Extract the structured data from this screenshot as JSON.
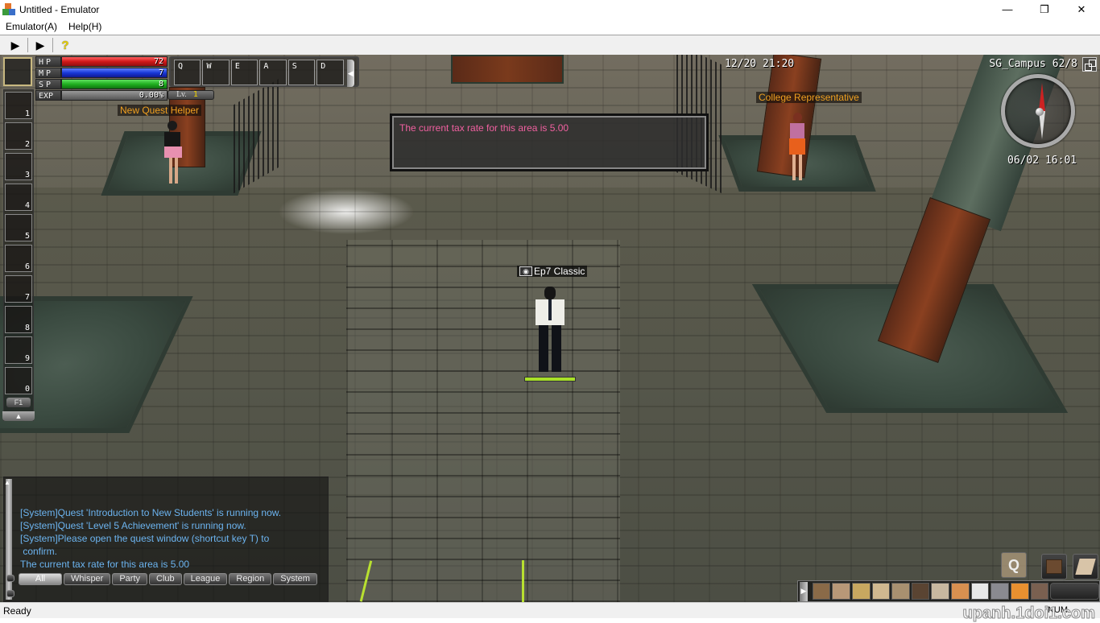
{
  "window": {
    "title": "Untitled - Emulator",
    "minimize_icon": "minimize-icon",
    "restore_icon": "restore-icon",
    "close_icon": "close-icon"
  },
  "menu": {
    "items": [
      "Emulator(A)",
      "Help(H)"
    ]
  },
  "toolbar": {
    "play_icon": "play-icon",
    "step_icon": "step-icon",
    "help_icon": "help-icon",
    "play_glyph": "▶",
    "step_glyph": "▶",
    "help_glyph": "?"
  },
  "hud": {
    "stats": [
      {
        "label": "HP",
        "value": "72",
        "fill": 1.0
      },
      {
        "label": "MP",
        "value": "7",
        "fill": 1.0
      },
      {
        "label": "SP",
        "value": "8",
        "fill": 1.0
      },
      {
        "label": "EXP",
        "value": "0.00%",
        "fill": 0.0
      }
    ],
    "level_label": "Lv.",
    "level": "1",
    "skill_slots": [
      "Q",
      "W",
      "E",
      "A",
      "S",
      "D"
    ],
    "skill_toggle_glyph": "◀",
    "quick_slots": [
      "1",
      "2",
      "3",
      "4",
      "5",
      "6",
      "7",
      "8",
      "9",
      "0"
    ],
    "quick_page": "F1",
    "quick_toggle_glyph": "▲",
    "game_clock": "12/20 21:20",
    "zone": "SG_Campus 62/8",
    "server_time": "06/02 16:01"
  },
  "world": {
    "npcs": [
      {
        "name": "New Quest Helper"
      },
      {
        "name": "College Representative"
      }
    ],
    "player": {
      "name": "Ep7 Classic",
      "hp_fill": 1.0
    }
  },
  "notice": {
    "text": "The current tax rate for this area is 5.00",
    "color": "#f060a0"
  },
  "chat": {
    "lines": [
      "[System]Quest 'Introduction to New Students' is running now.",
      "[System]Quest 'Level 5 Achievement' is running now.",
      "[System]Please open the quest window (shortcut key T) to",
      " confirm.",
      "The current tax rate for this area is 5.00"
    ],
    "tabs": [
      "All",
      "Whisper",
      "Party",
      "Club",
      "League",
      "Region",
      "System"
    ],
    "active_tab": "All",
    "text_color": "#6cb4f0"
  },
  "game_menu": {
    "icons": [
      "bag-icon",
      "character-icon",
      "map-icon",
      "skill-icon",
      "quest-book-icon",
      "inventory-icon",
      "club-icon",
      "world-map-icon",
      "system-icon",
      "gift-icon",
      "event-gift-icon",
      "dance-icon",
      "more-icon"
    ],
    "quest_button_glyph": "Q",
    "expand_glyph": "▶"
  },
  "status": {
    "text": "Ready",
    "num": "NUM"
  },
  "watermark": "upanh.1doi1.com"
}
